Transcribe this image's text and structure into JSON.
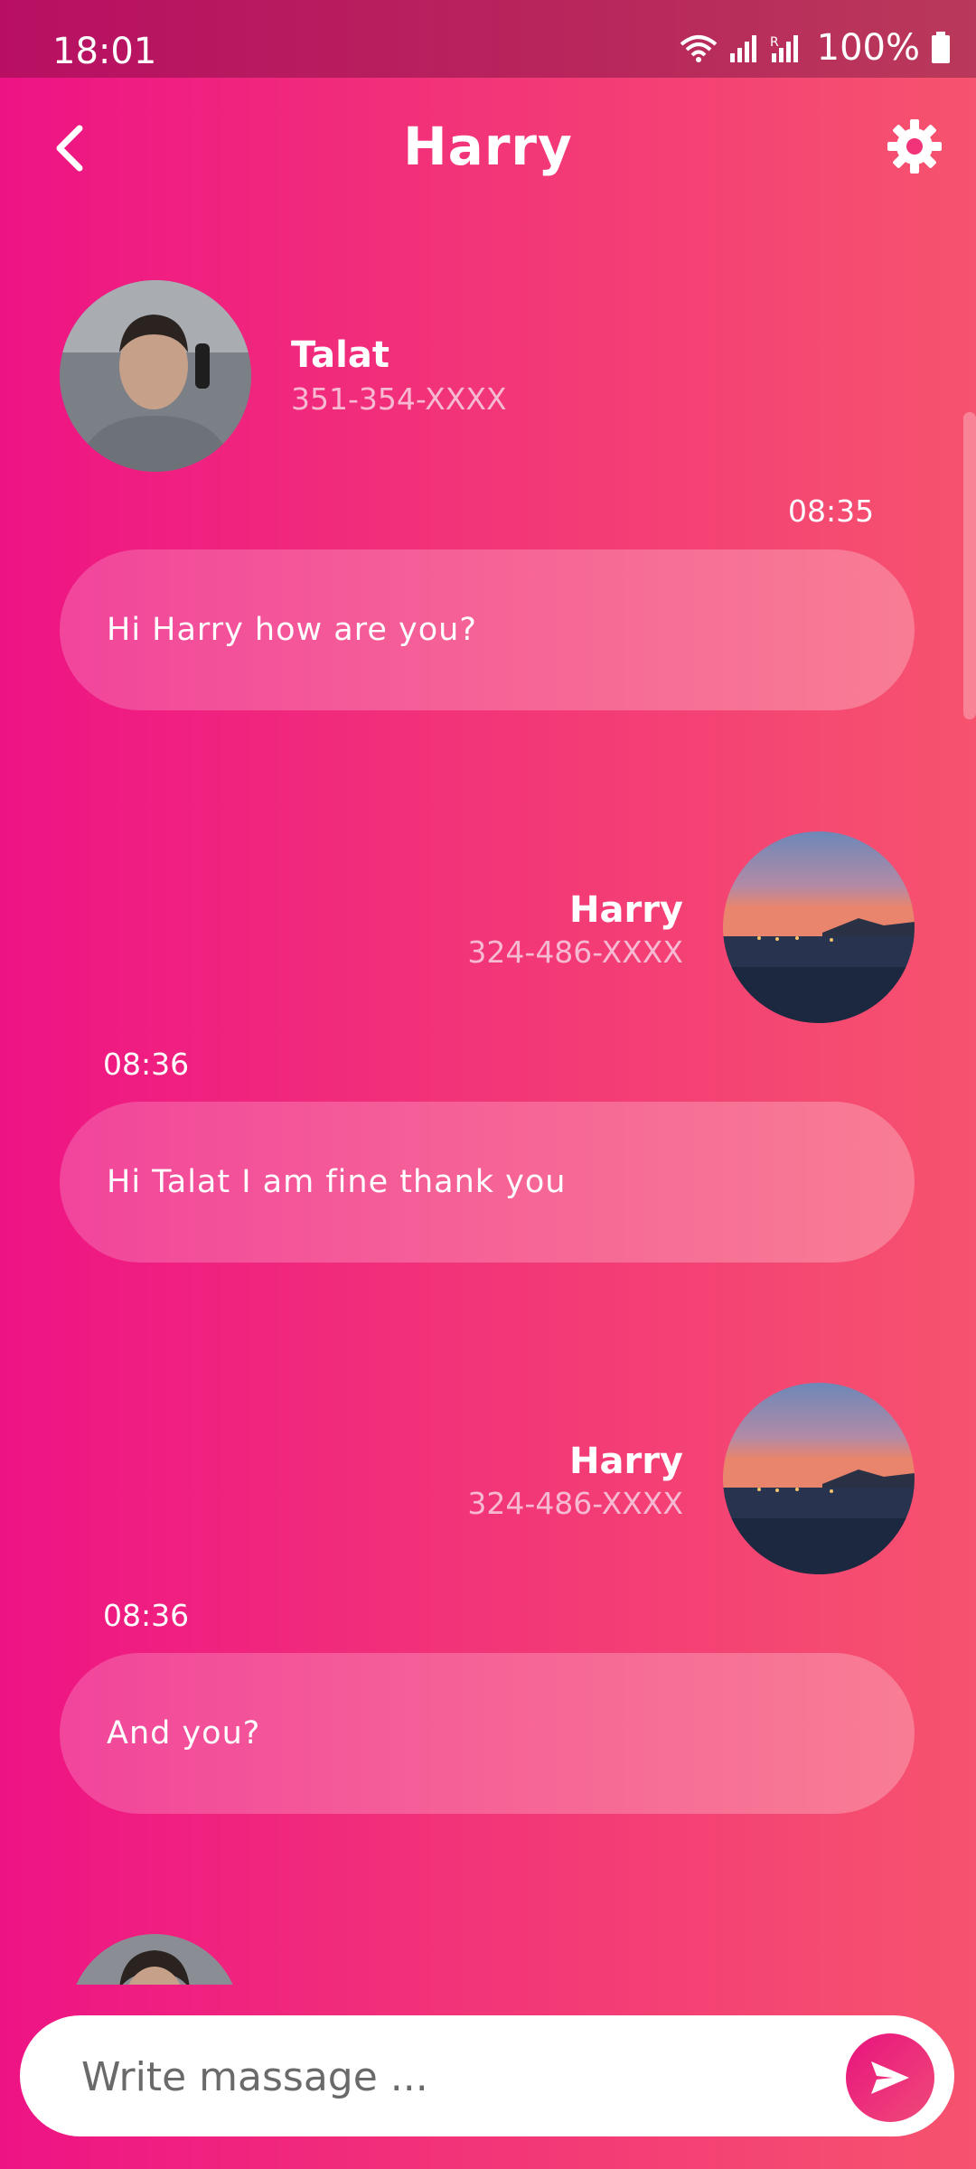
{
  "status_bar": {
    "time": "18:01",
    "battery": "100%",
    "icons": [
      "wifi-icon",
      "signal-icon",
      "signal-roaming-icon",
      "battery-icon"
    ]
  },
  "header": {
    "title": "Harry",
    "back_icon": "chevron-left-icon",
    "settings_icon": "gear-icon"
  },
  "messages": [
    {
      "sender": "Talat",
      "phone": "351-354-XXXX",
      "time": "08:35",
      "text": "Hi Harry how are you?"
    },
    {
      "sender": "Harry",
      "phone": "324-486-XXXX",
      "time": "08:36",
      "text": "Hi Talat I am fine thank you"
    },
    {
      "sender": "Harry",
      "phone": "324-486-XXXX",
      "time": "08:36",
      "text": "And you?"
    }
  ],
  "composer": {
    "placeholder": "Write massage ...",
    "send_icon": "send-icon"
  },
  "colors": {
    "gradient_start": "#ee1385",
    "gradient_end": "#f6536e",
    "status_bar": "#b80f63",
    "phone_text": "#f7b9d2"
  }
}
